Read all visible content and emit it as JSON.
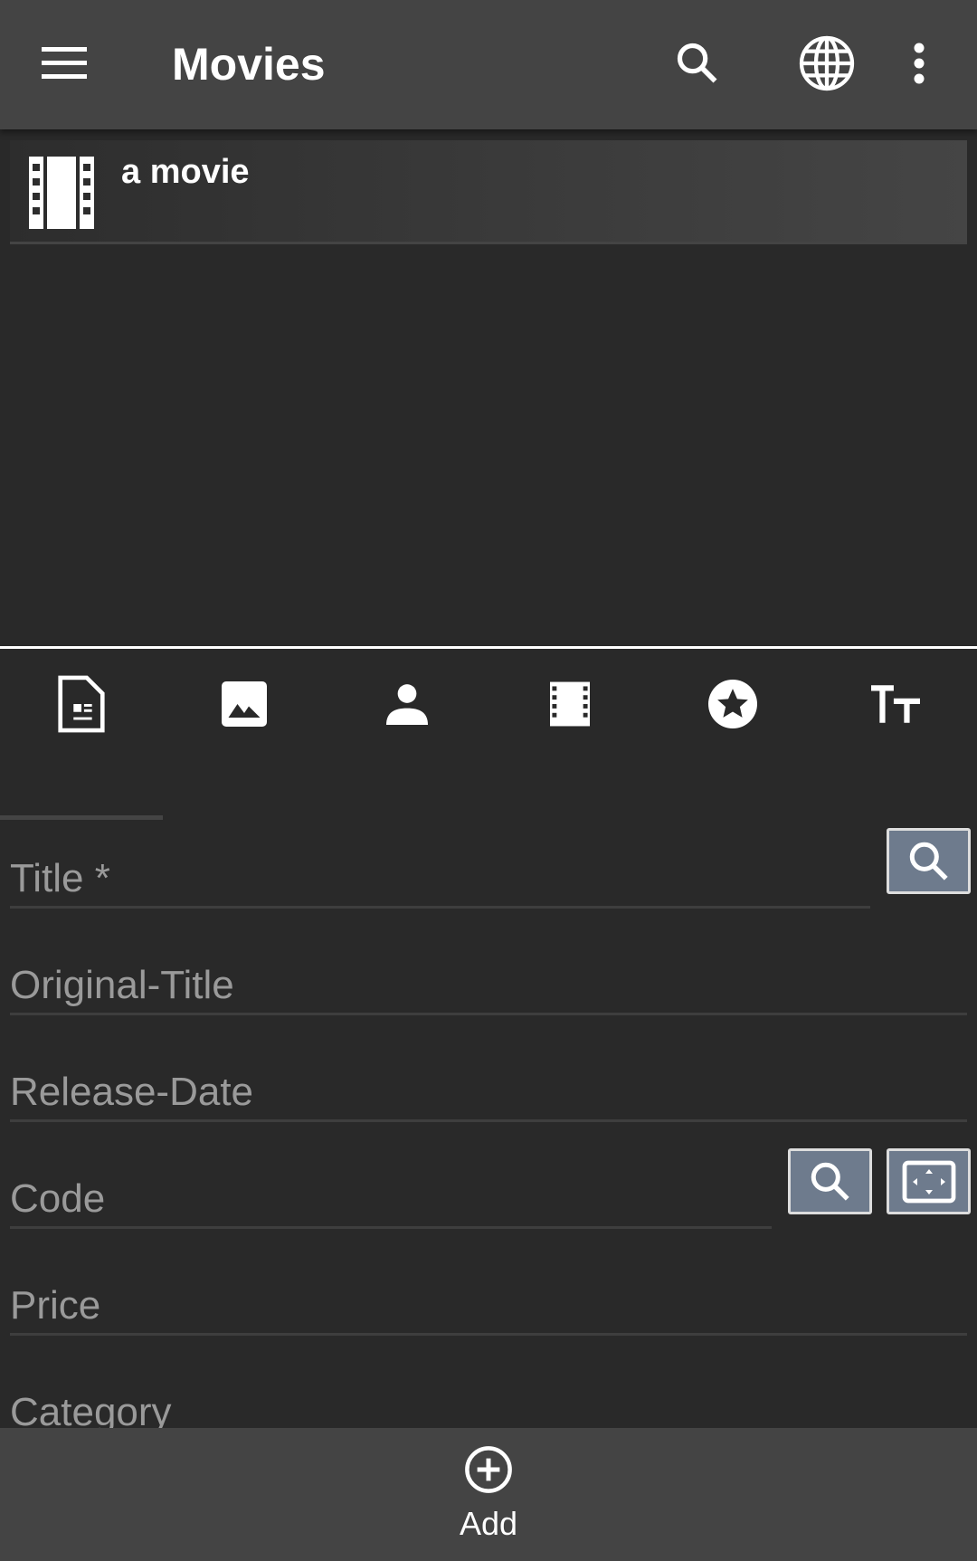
{
  "appbar": {
    "title": "Movies",
    "icons": [
      "menu-icon",
      "search-icon",
      "globe-icon",
      "more-vert-icon"
    ]
  },
  "list": {
    "items": [
      {
        "title": "a movie",
        "icon": "movie-icon"
      }
    ]
  },
  "tabs": [
    {
      "icon": "document-icon"
    },
    {
      "icon": "image-icon"
    },
    {
      "icon": "person-icon"
    },
    {
      "icon": "movie-icon"
    },
    {
      "icon": "star-icon"
    },
    {
      "icon": "text-size-icon"
    }
  ],
  "form": {
    "title_label": "Title *",
    "original_title_label": "Original-Title",
    "release_date_label": "Release-Date",
    "code_label": "Code",
    "price_label": "Price",
    "category_label": "Category"
  },
  "bottom": {
    "add_label": "Add"
  },
  "colors": {
    "appbar": "#444444",
    "background": "#292929",
    "button": "#6e7b8d"
  }
}
